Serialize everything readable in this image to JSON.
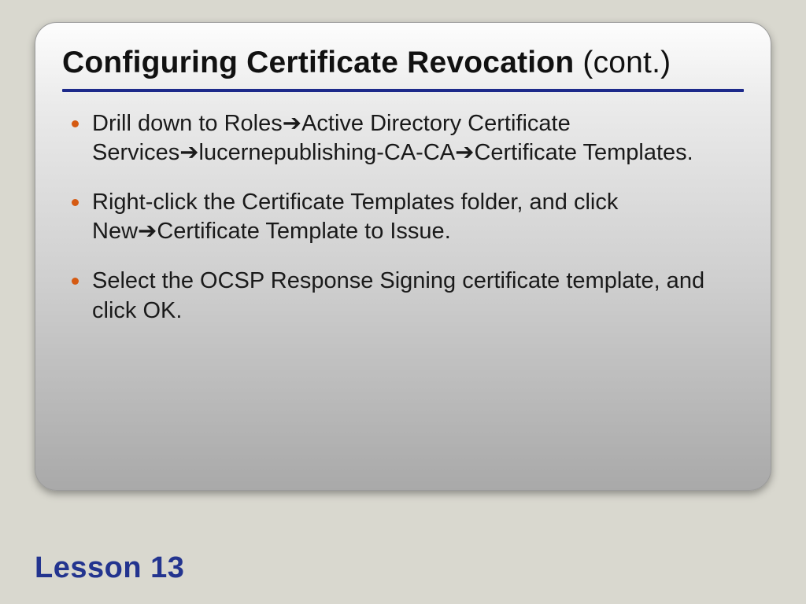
{
  "title_main": "Configuring Certificate Revocation",
  "title_suffix": " (cont.)",
  "arrow": "➔",
  "bullets": [
    {
      "parts": [
        "Drill down to Roles",
        "ARROW",
        "Active Directory Certificate Services",
        "ARROW",
        "lucernepublishing-CA-CA",
        "ARROW",
        "Certificate Templates."
      ]
    },
    {
      "parts": [
        "Right-click the Certificate Templates folder, and click New",
        "ARROW",
        "Certificate Template to Issue."
      ]
    },
    {
      "parts": [
        "Select the OCSP Response Signing certificate template, and click OK."
      ]
    }
  ],
  "footer": "Lesson 13"
}
